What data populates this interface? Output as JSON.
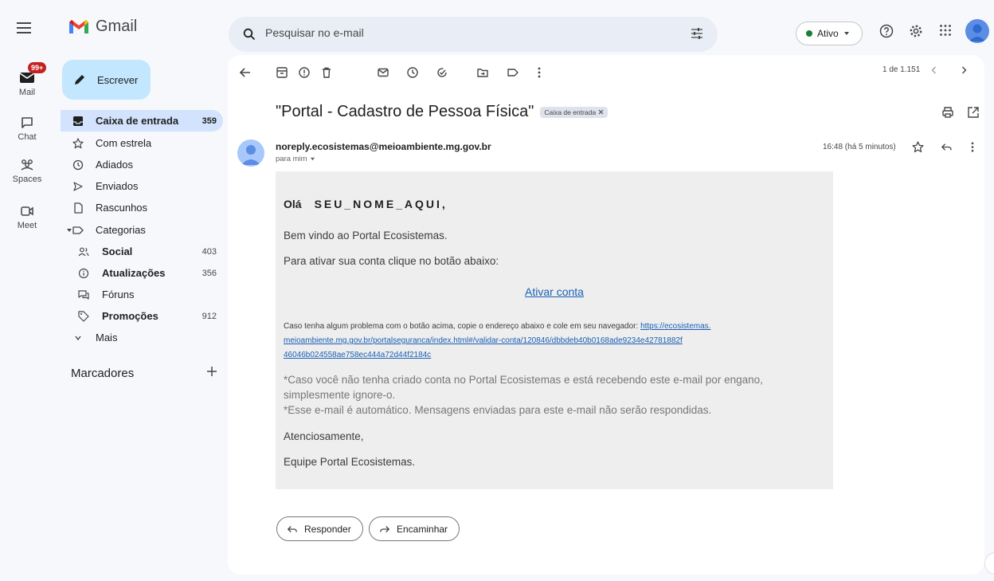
{
  "app": {
    "name": "Gmail"
  },
  "rail": {
    "mail_label": "Mail",
    "mail_badge": "99+",
    "chat_label": "Chat",
    "spaces_label": "Spaces",
    "meet_label": "Meet"
  },
  "sidebar": {
    "compose_label": "Escrever",
    "items": [
      {
        "label": "Caixa de entrada",
        "count": "359"
      },
      {
        "label": "Com estrela",
        "count": ""
      },
      {
        "label": "Adiados",
        "count": ""
      },
      {
        "label": "Enviados",
        "count": ""
      },
      {
        "label": "Rascunhos",
        "count": ""
      },
      {
        "label": "Categorias",
        "count": ""
      },
      {
        "label": "Social",
        "count": "403"
      },
      {
        "label": "Atualizações",
        "count": "356"
      },
      {
        "label": "Fóruns",
        "count": ""
      },
      {
        "label": "Promoções",
        "count": "912"
      },
      {
        "label": "Mais",
        "count": ""
      }
    ],
    "labels_heading": "Marcadores"
  },
  "header": {
    "search_placeholder": "Pesquisar no e-mail",
    "status": "Ativo"
  },
  "toolbar": {
    "pager": "1 de 1.151"
  },
  "email": {
    "subject": "\"Portal - Cadastro de Pessoa Física\"",
    "label_chip": "Caixa de entrada",
    "sender": "noreply.ecosistemas@meioambiente.mg.gov.br",
    "to": "para mim",
    "time": "16:48 (há 5 minutos)",
    "greeting": "Olá",
    "name": "SEU_NOME_AQUI,",
    "welcome": "Bem vindo ao Portal Ecosistemas.",
    "activate_prompt": "Para ativar sua conta clique no botão abaixo:",
    "activate_link": "Ativar conta",
    "problem_text": "Caso tenha algum problema com o botão acima, copie o endereço abaixo e cole em seu navegador:",
    "url_line1": "https://ecosistemas.",
    "url_line2": "meioambiente.mg.gov.br/portalseguranca/index.html#/validar-conta/120846/dbbdeb40b0168ade9234e42781882f",
    "url_line3": "46046b024558ae758ec444a72d44f2184c",
    "note1": "*Caso você não tenha criado conta no Portal Ecosistemas e está recebendo este e-mail por engano, simplesmente ignore-o.",
    "note2": "*Esse e-mail é automático. Mensagens enviadas para este e-mail não serão respondidas.",
    "regards": "Atenciosamente,",
    "team": "Equipe Portal Ecosistemas."
  },
  "actions": {
    "reply": "Responder",
    "forward": "Encaminhar"
  },
  "colors": {
    "compose_bg": "#c2e7ff",
    "active_nav": "#d3e3fd",
    "badge": "#c5221f",
    "link": "#1a5fb4"
  }
}
